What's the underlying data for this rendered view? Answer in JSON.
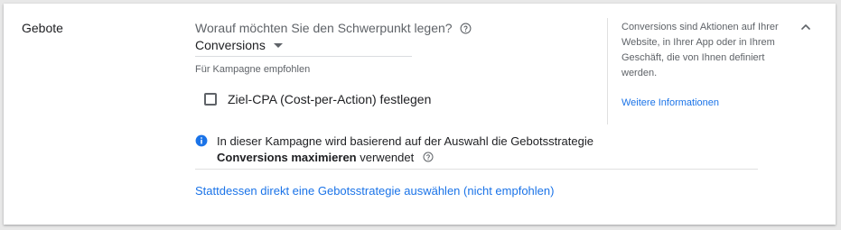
{
  "section": {
    "title": "Gebote"
  },
  "focus": {
    "question": "Worauf möchten Sie den Schwerpunkt legen?",
    "selected_value": "Conversions",
    "recommended_label": "Für Kampagne empfohlen"
  },
  "target_cpa": {
    "label": "Ziel-CPA (Cost-per-Action) festlegen",
    "checked": false
  },
  "info": {
    "text_before": "In dieser Kampagne wird basierend auf der Auswahl die Gebotsstrategie",
    "strategy": "Conversions maximieren",
    "text_after": "verwendet"
  },
  "alt_link": "Stattdessen direkt eine Gebotsstrategie auswählen (nicht empfohlen)",
  "side": {
    "description": "Conversions sind Aktionen auf Ihrer Website, in Ihrer App oder in Ihrem Geschäft, die von Ihnen definiert werden.",
    "link": "Weitere Informationen"
  },
  "colors": {
    "accent": "#1a73e8",
    "info_icon": "#1a73e8",
    "secondary_text": "#5f6368"
  },
  "icons": {
    "help": "help-circle-icon",
    "info": "info-icon",
    "collapse": "chevron-up-icon",
    "dropdown": "caret-down-icon"
  }
}
